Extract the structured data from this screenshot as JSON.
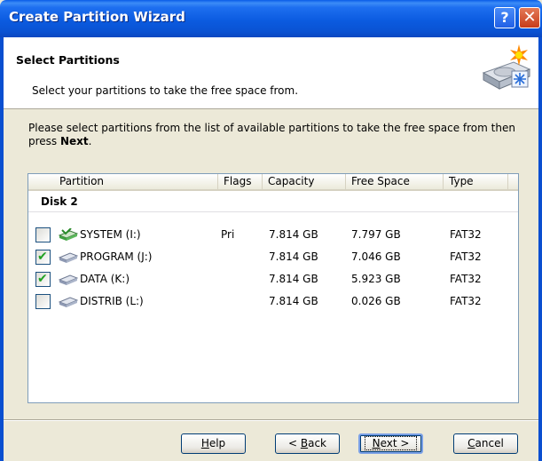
{
  "window": {
    "title": "Create Partition Wizard",
    "help_label": "?",
    "close_label": "✕"
  },
  "header": {
    "title": "Select Partitions",
    "subtitle": "Select your partitions to take the free space from.",
    "icon": "disk-wizard-icon"
  },
  "intro": {
    "text": "Please select partitions from the list of available partitions to take the free space from then press ",
    "bold": "Next",
    "suffix": "."
  },
  "list": {
    "columns": [
      "Partition",
      "Flags",
      "Capacity",
      "Free Space",
      "Type"
    ],
    "group": "Disk 2",
    "rows": [
      {
        "checked": false,
        "name": "SYSTEM (I:)",
        "flags": "Pri",
        "capacity": "7.814 GB",
        "free": "7.797 GB",
        "type": "FAT32"
      },
      {
        "checked": true,
        "name": "PROGRAM (J:)",
        "flags": "",
        "capacity": "7.814 GB",
        "free": "7.046 GB",
        "type": "FAT32"
      },
      {
        "checked": true,
        "name": "DATA (K:)",
        "flags": "",
        "capacity": "7.814 GB",
        "free": "5.923 GB",
        "type": "FAT32"
      },
      {
        "checked": false,
        "name": "DISTRIB (L:)",
        "flags": "",
        "capacity": "7.814 GB",
        "free": "0.026 GB",
        "type": "FAT32"
      }
    ]
  },
  "buttons": {
    "help": {
      "pre": "",
      "u": "H",
      "post": "elp"
    },
    "back": {
      "pre": "< ",
      "u": "B",
      "post": "ack"
    },
    "next": {
      "pre": "",
      "u": "N",
      "post": "ext >"
    },
    "cancel": {
      "pre": "",
      "u": "C",
      "post": "ancel"
    }
  },
  "colors": {
    "titlebar": "#0a5ce8",
    "check": "#21a121",
    "system_icon": "#3fa03f"
  }
}
